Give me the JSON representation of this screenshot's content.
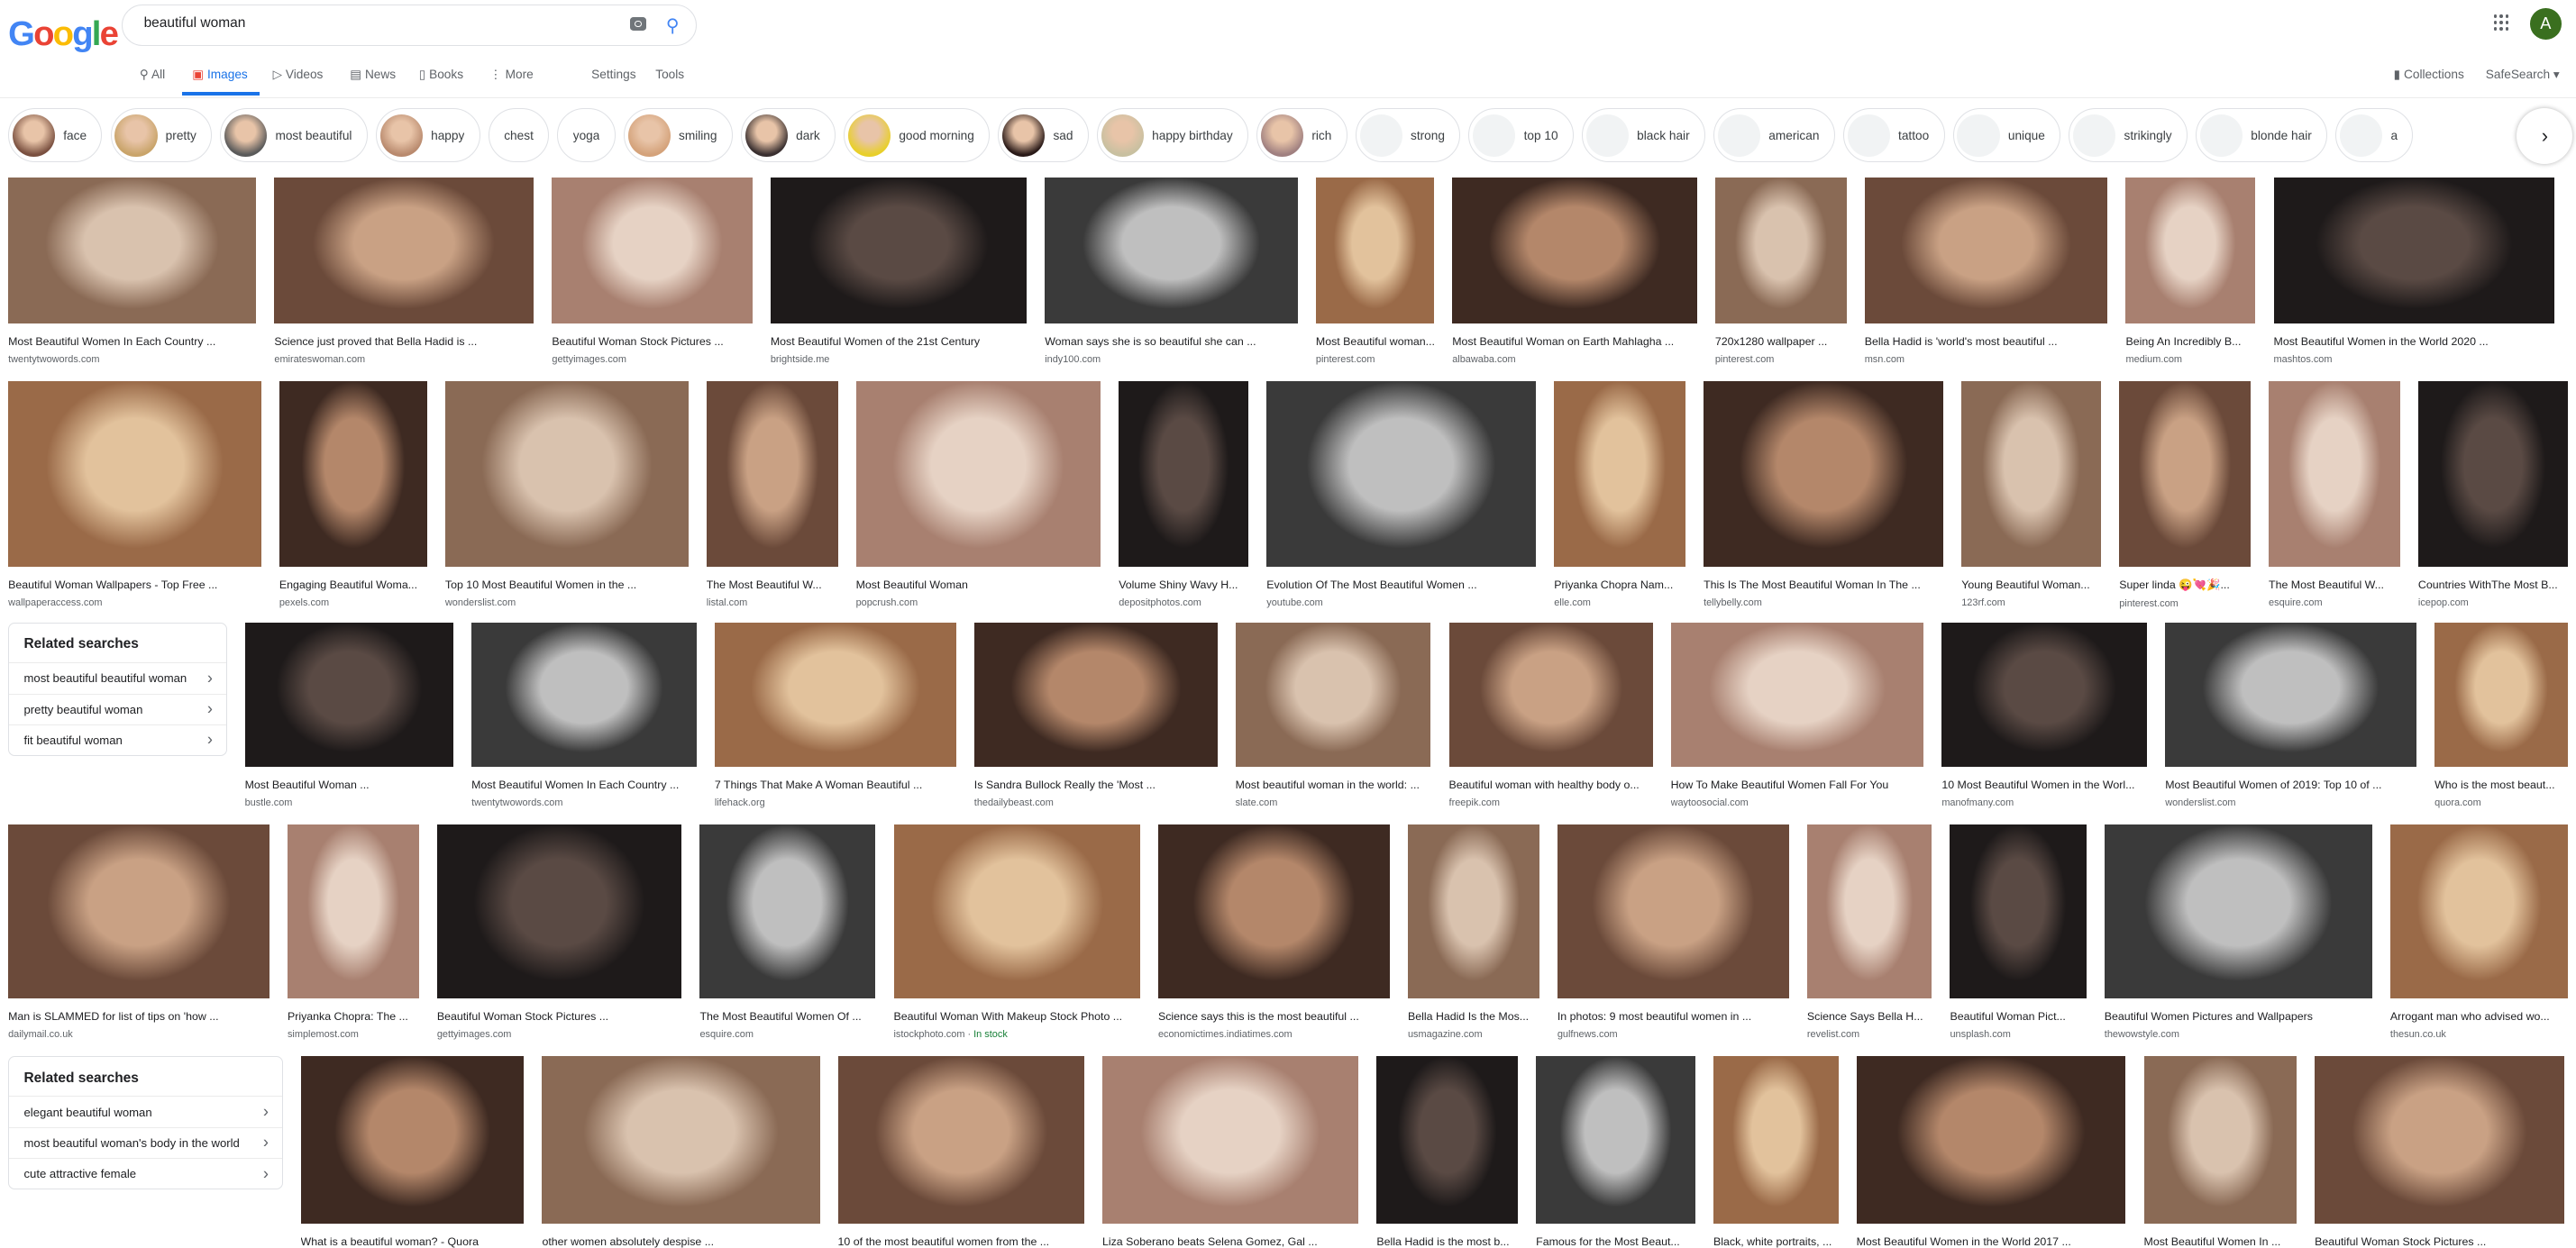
{
  "header": {
    "logo": "Google",
    "query": "beautiful woman",
    "avatar_letter": "A",
    "collections": "Collections",
    "safesearch": "SafeSearch ▾"
  },
  "nav": {
    "all": "All",
    "images": "Images",
    "videos": "Videos",
    "news": "News",
    "books": "Books",
    "more": "More",
    "settings": "Settings",
    "tools": "Tools",
    "active": "Images"
  },
  "colors": {
    "accent": "#1a73e8",
    "avatar": "#3a6f1f",
    "in_stock": "#188038"
  },
  "chips": [
    {
      "label": "face",
      "img": true
    },
    {
      "label": "pretty",
      "img": true
    },
    {
      "label": "most beautiful",
      "img": true
    },
    {
      "label": "happy",
      "img": true
    },
    {
      "label": "chest",
      "img": false
    },
    {
      "label": "yoga",
      "img": false
    },
    {
      "label": "smiling",
      "img": true
    },
    {
      "label": "dark",
      "img": true
    },
    {
      "label": "good morning",
      "img": true
    },
    {
      "label": "sad",
      "img": true
    },
    {
      "label": "happy birthday",
      "img": true
    },
    {
      "label": "rich",
      "img": true
    },
    {
      "label": "strong",
      "img": "placeholder"
    },
    {
      "label": "top 10",
      "img": "placeholder"
    },
    {
      "label": "black hair",
      "img": "placeholder"
    },
    {
      "label": "american",
      "img": "placeholder"
    },
    {
      "label": "tattoo",
      "img": "placeholder"
    },
    {
      "label": "unique",
      "img": "placeholder"
    },
    {
      "label": "strikingly",
      "img": "placeholder"
    },
    {
      "label": "blonde hair",
      "img": "placeholder"
    },
    {
      "label": "a",
      "img": "placeholder"
    }
  ],
  "related_1": {
    "title": "Related searches",
    "items": [
      "most beautiful beautiful woman",
      "pretty beautiful woman",
      "fit beautiful woman"
    ]
  },
  "related_2": {
    "title": "Related searches",
    "items": [
      "elegant beautiful woman",
      "most beautiful woman's body in the world",
      "cute attractive female"
    ]
  },
  "rows": [
    [
      {
        "caption": "Most Beautiful Women In Each Country ...",
        "source": "twentytwowords.com"
      },
      {
        "caption": "Science just proved that Bella Hadid is ...",
        "source": "emirateswoman.com"
      },
      {
        "caption": "Beautiful Woman Stock Pictures ...",
        "source": "gettyimages.com"
      },
      {
        "caption": "Most Beautiful Women of the 21st Century",
        "source": "brightside.me"
      },
      {
        "caption": "Woman says she is so beautiful she can ...",
        "source": "indy100.com"
      },
      {
        "caption": "Most Beautiful woman...",
        "source": "pinterest.com"
      },
      {
        "caption": "Most Beautiful Woman on Earth Mahlagha ...",
        "source": "albawaba.com"
      },
      {
        "caption": "720x1280 wallpaper ...",
        "source": "pinterest.com"
      },
      {
        "caption": "Bella Hadid is 'world's most beautiful ...",
        "source": "msn.com"
      },
      {
        "caption": "Being An Incredibly B...",
        "source": "medium.com"
      },
      {
        "caption": "Most Beautiful Women in the World 2020 ...",
        "source": "mashtos.com"
      }
    ],
    [
      {
        "caption": "Beautiful Woman Wallpapers - Top Free ...",
        "source": "wallpaperaccess.com"
      },
      {
        "caption": "Engaging Beautiful Woma...",
        "source": "pexels.com"
      },
      {
        "caption": "Top 10 Most Beautiful Women in the ...",
        "source": "wonderslist.com"
      },
      {
        "caption": "The Most Beautiful W...",
        "source": "listal.com"
      },
      {
        "caption": "Most Beautiful Woman",
        "source": "popcrush.com"
      },
      {
        "caption": "Volume Shiny Wavy H...",
        "source": "depositphotos.com"
      },
      {
        "caption": "Evolution Of The Most Beautiful Women ...",
        "source": "youtube.com"
      },
      {
        "caption": "Priyanka Chopra Nam...",
        "source": "elle.com"
      },
      {
        "caption": "This Is The Most Beautiful Woman In The ...",
        "source": "tellybelly.com"
      },
      {
        "caption": "Young Beautiful Woman...",
        "source": "123rf.com"
      },
      {
        "caption": "Super linda 😜💘🎉...",
        "source": "pinterest.com"
      },
      {
        "caption": "The Most Beautiful W...",
        "source": "esquire.com"
      },
      {
        "caption": "Countries WithThe Most B...",
        "source": "icepop.com"
      }
    ],
    [
      {
        "caption": "Most Beautiful Woman ...",
        "source": "bustle.com"
      },
      {
        "caption": "Most Beautiful Women In Each Country ...",
        "source": "twentytwowords.com"
      },
      {
        "caption": "7 Things That Make A Woman Beautiful ...",
        "source": "lifehack.org"
      },
      {
        "caption": "Is Sandra Bullock Really the 'Most ...",
        "source": "thedailybeast.com"
      },
      {
        "caption": "Most beautiful woman in the world: ...",
        "source": "slate.com"
      },
      {
        "caption": "Beautiful woman with healthy body o...",
        "source": "freepik.com"
      },
      {
        "caption": "How To Make Beautiful Women Fall For You",
        "source": "waytoosocial.com"
      },
      {
        "caption": "10 Most Beautiful Women in the Worl...",
        "source": "manofmany.com"
      },
      {
        "caption": "Most Beautiful Women of 2019: Top 10 of ...",
        "source": "wonderslist.com"
      },
      {
        "caption": "Who is the most beaut...",
        "source": "quora.com"
      }
    ],
    [
      {
        "caption": "Man is SLAMMED for list of tips on 'how ...",
        "source": "dailymail.co.uk"
      },
      {
        "caption": "Priyanka Chopra: The ...",
        "source": "simplemost.com"
      },
      {
        "caption": "Beautiful Woman Stock Pictures ...",
        "source": "gettyimages.com"
      },
      {
        "caption": "The Most Beautiful Women Of ...",
        "source": "esquire.com"
      },
      {
        "caption": "Beautiful Woman With Makeup Stock Photo ...",
        "source": "istockphoto.com",
        "stock": "In stock"
      },
      {
        "caption": "Science says this is the most beautiful ...",
        "source": "economictimes.indiatimes.com"
      },
      {
        "caption": "Bella Hadid Is the Mos...",
        "source": "usmagazine.com"
      },
      {
        "caption": "In photos: 9 most beautiful women in ...",
        "source": "gulfnews.com"
      },
      {
        "caption": "Science Says Bella H...",
        "source": "revelist.com"
      },
      {
        "caption": "Beautiful Woman Pict...",
        "source": "unsplash.com"
      },
      {
        "caption": "Beautiful Women Pictures and Wallpapers",
        "source": "thewowstyle.com"
      },
      {
        "caption": "Arrogant man who advised wo...",
        "source": "thesun.co.uk"
      }
    ],
    [
      {
        "caption": "What is a beautiful woman? - Quora"
      },
      {
        "caption": "other women absolutely despise ..."
      },
      {
        "caption": "10 of the most beautiful women from the ..."
      },
      {
        "caption": "Liza Soberano beats Selena Gomez, Gal ..."
      },
      {
        "caption": "Bella Hadid is the most b..."
      },
      {
        "caption": "Famous for the Most Beaut..."
      },
      {
        "caption": "Black, white portraits, ..."
      },
      {
        "caption": "Most Beautiful Women in the World 2017 ..."
      },
      {
        "caption": "Most Beautiful Women In ..."
      },
      {
        "caption": "Beautiful Woman Stock Pictures ..."
      }
    ]
  ]
}
